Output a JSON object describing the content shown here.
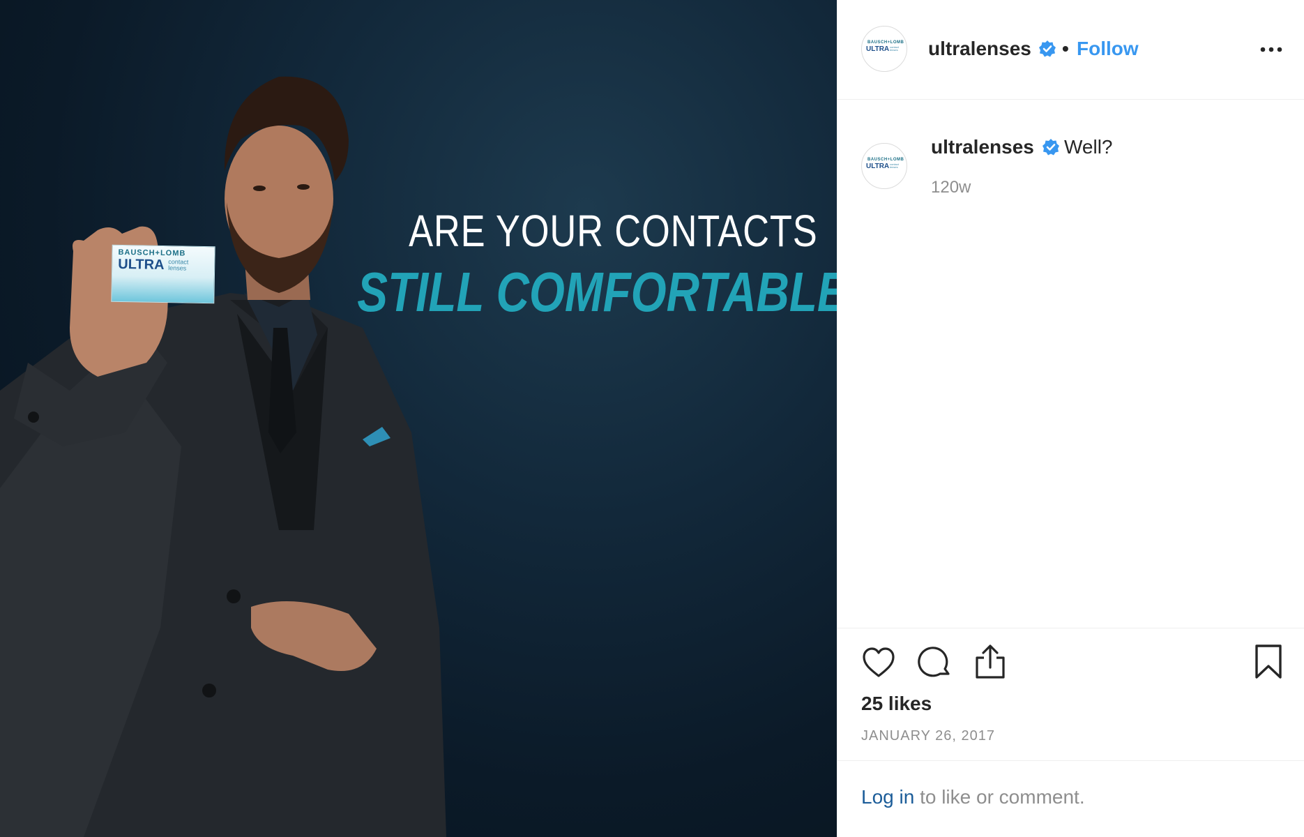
{
  "post": {
    "image": {
      "headline_line1": "ARE YOUR CONTACTS",
      "headline_line2": "STILL COMFORTABLE?",
      "product_brand": "BAUSCH+LOMB",
      "product_name": "ULTRA",
      "product_desc": "contact lenses",
      "headline_color": "#22a3b7"
    },
    "header": {
      "username": "ultralenses",
      "separator": "•",
      "follow_label": "Follow",
      "verified_icon": "verified-badge-icon",
      "more_icon": "more-options-icon"
    },
    "avatar": {
      "brand": "BAUSCH+LOMB",
      "name": "ULTRA",
      "desc": "contact lenses"
    },
    "comment": {
      "username": "ultralenses",
      "text": "Well?",
      "time": "120w"
    },
    "actions": {
      "like_icon": "heart-icon",
      "comment_icon": "comment-bubble-icon",
      "share_icon": "share-icon",
      "save_icon": "bookmark-icon"
    },
    "likes": "25 likes",
    "date": "JANUARY 26, 2017",
    "login": {
      "link": "Log in",
      "rest": " to like or comment."
    }
  },
  "colors": {
    "accent": "#3897f0",
    "verified": "#3897f0",
    "muted": "#8e8e8e"
  }
}
